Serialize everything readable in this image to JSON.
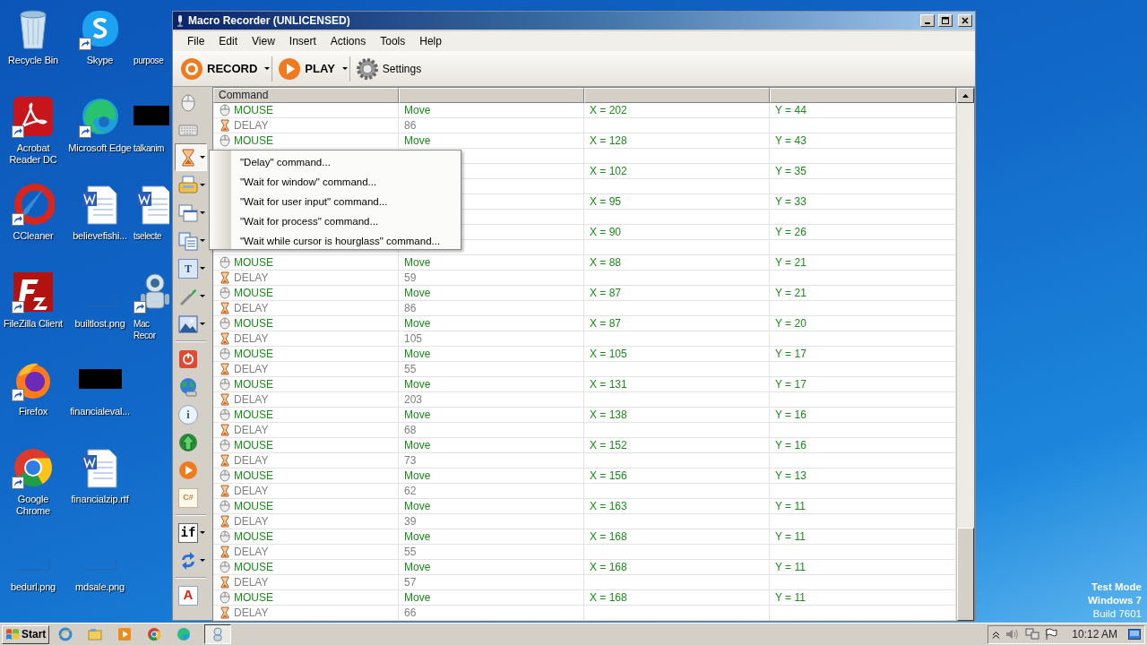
{
  "desktop_icons": [
    {
      "label": "Recycle Bin",
      "kind": "recycle",
      "shortcut": false
    },
    {
      "label": "Acrobat Reader DC",
      "kind": "acrobat",
      "shortcut": true
    },
    {
      "label": "CCleaner",
      "kind": "ccleaner",
      "shortcut": true
    },
    {
      "label": "FileZilla Client",
      "kind": "filezilla",
      "shortcut": true
    },
    {
      "label": "Firefox",
      "kind": "firefox",
      "shortcut": true
    },
    {
      "label": "Google Chrome",
      "kind": "chrome",
      "shortcut": true
    },
    {
      "label": "bedurl.png",
      "kind": "image",
      "shortcut": false
    },
    {
      "label": "Skype",
      "kind": "skype",
      "shortcut": true
    },
    {
      "label": "Microsoft Edge",
      "kind": "edge",
      "shortcut": true
    },
    {
      "label": "believefishi...",
      "kind": "document",
      "shortcut": false
    },
    {
      "label": "builtlost.png",
      "kind": "image",
      "shortcut": false
    },
    {
      "label": "financialeval...",
      "kind": "blackimage",
      "shortcut": false
    },
    {
      "label": "financialzip.rtf",
      "kind": "document",
      "shortcut": false
    },
    {
      "label": "mdsale.png",
      "kind": "image",
      "shortcut": false
    },
    {
      "label": "purpose",
      "kind": "none"
    },
    {
      "label": "talkanim",
      "kind": "blackimage",
      "shortcut": false
    },
    {
      "label": "tselecte",
      "kind": "document",
      "shortcut": false
    },
    {
      "label": "Mac Recor",
      "kind": "robot",
      "shortcut": true
    }
  ],
  "window": {
    "title": "Macro Recorder (UNLICENSED)"
  },
  "menu": [
    "File",
    "Edit",
    "View",
    "Insert",
    "Actions",
    "Tools",
    "Help"
  ],
  "toolbar": [
    {
      "label": "RECORD",
      "kind": "record",
      "dropdown": true
    },
    {
      "label": "PLAY",
      "kind": "play",
      "dropdown": true
    },
    {
      "label": "Settings",
      "kind": "settings",
      "dropdown": false
    }
  ],
  "left_toolbar": [
    {
      "kind": "mouse",
      "dropdown": false,
      "pressed": false
    },
    {
      "kind": "keyboard",
      "dropdown": false,
      "pressed": false
    },
    {
      "kind": "hourglass",
      "dropdown": true,
      "pressed": true
    },
    {
      "kind": "printer",
      "dropdown": true,
      "pressed": false
    },
    {
      "kind": "windows",
      "dropdown": true,
      "pressed": false
    },
    {
      "kind": "documents",
      "dropdown": true,
      "pressed": false
    },
    {
      "kind": "text",
      "label": "T",
      "dropdown": true,
      "pressed": false
    },
    {
      "kind": "eyedropper",
      "dropdown": true,
      "pressed": false
    },
    {
      "kind": "picture",
      "dropdown": true,
      "pressed": false
    },
    {
      "kind": "separator"
    },
    {
      "kind": "power",
      "dropdown": false,
      "pressed": false
    },
    {
      "kind": "globe",
      "dropdown": false,
      "pressed": false
    },
    {
      "kind": "info",
      "label": "i",
      "dropdown": false,
      "pressed": false
    },
    {
      "kind": "upload",
      "dropdown": false,
      "pressed": false
    },
    {
      "kind": "play",
      "dropdown": false,
      "pressed": false
    },
    {
      "kind": "code",
      "label": "C#",
      "dropdown": false,
      "pressed": false
    },
    {
      "kind": "separator"
    },
    {
      "kind": "condition",
      "label": "if",
      "dropdown": true,
      "pressed": false
    },
    {
      "kind": "loop",
      "dropdown": true,
      "pressed": false
    },
    {
      "kind": "separator"
    },
    {
      "kind": "font",
      "label": "A",
      "dropdown": false,
      "pressed": false
    }
  ],
  "table": {
    "columns": [
      "Command"
    ],
    "rows": [
      {
        "kind": "mouse",
        "command": "MOUSE",
        "action": "Move",
        "x": "X = 202",
        "y": "Y = 44"
      },
      {
        "kind": "delay",
        "command": "DELAY",
        "action": "86"
      },
      {
        "kind": "mouse",
        "command": "MOUSE",
        "action": "Move",
        "x": "X = 128",
        "y": "Y = 43"
      },
      {
        "kind": "delay"
      },
      {
        "kind": "mouse",
        "x": "X = 102",
        "y": "Y = 35"
      },
      {
        "kind": "delay"
      },
      {
        "kind": "mouse",
        "x": "X = 95",
        "y": "Y = 33"
      },
      {
        "kind": "delay"
      },
      {
        "kind": "mouse",
        "x": "X = 90",
        "y": "Y = 26"
      },
      {
        "kind": "delay"
      },
      {
        "kind": "mouse",
        "command": "MOUSE",
        "action": "Move",
        "x": "X = 88",
        "y": "Y = 21"
      },
      {
        "kind": "delay",
        "command": "DELAY",
        "action": "59"
      },
      {
        "kind": "mouse",
        "command": "MOUSE",
        "action": "Move",
        "x": "X = 87",
        "y": "Y = 21"
      },
      {
        "kind": "delay",
        "command": "DELAY",
        "action": "86"
      },
      {
        "kind": "mouse",
        "command": "MOUSE",
        "action": "Move",
        "x": "X = 87",
        "y": "Y = 20"
      },
      {
        "kind": "delay",
        "command": "DELAY",
        "action": "105"
      },
      {
        "kind": "mouse",
        "command": "MOUSE",
        "action": "Move",
        "x": "X = 105",
        "y": "Y = 17"
      },
      {
        "kind": "delay",
        "command": "DELAY",
        "action": "55"
      },
      {
        "kind": "mouse",
        "command": "MOUSE",
        "action": "Move",
        "x": "X = 131",
        "y": "Y = 17"
      },
      {
        "kind": "delay",
        "command": "DELAY",
        "action": "203"
      },
      {
        "kind": "mouse",
        "command": "MOUSE",
        "action": "Move",
        "x": "X = 138",
        "y": "Y = 16"
      },
      {
        "kind": "delay",
        "command": "DELAY",
        "action": "68"
      },
      {
        "kind": "mouse",
        "command": "MOUSE",
        "action": "Move",
        "x": "X = 152",
        "y": "Y = 16"
      },
      {
        "kind": "delay",
        "command": "DELAY",
        "action": "73"
      },
      {
        "kind": "mouse",
        "command": "MOUSE",
        "action": "Move",
        "x": "X = 156",
        "y": "Y = 13"
      },
      {
        "kind": "delay",
        "command": "DELAY",
        "action": "62"
      },
      {
        "kind": "mouse",
        "command": "MOUSE",
        "action": "Move",
        "x": "X = 163",
        "y": "Y = 11"
      },
      {
        "kind": "delay",
        "command": "DELAY",
        "action": "39"
      },
      {
        "kind": "mouse",
        "command": "MOUSE",
        "action": "Move",
        "x": "X = 168",
        "y": "Y = 11"
      },
      {
        "kind": "delay",
        "command": "DELAY",
        "action": "55"
      },
      {
        "kind": "mouse",
        "command": "MOUSE",
        "action": "Move",
        "x": "X = 168",
        "y": "Y = 11"
      },
      {
        "kind": "delay",
        "command": "DELAY",
        "action": "57"
      },
      {
        "kind": "mouse",
        "command": "MOUSE",
        "action": "Move",
        "x": "X = 168",
        "y": "Y = 11"
      },
      {
        "kind": "delay",
        "command": "DELAY",
        "action": "66"
      }
    ]
  },
  "popup_menu": [
    "\"Delay\" command...",
    "\"Wait for window\" command...",
    "\"Wait for user input\" command...",
    "\"Wait for process\" command...",
    "\"Wait while cursor is hourglass\" command..."
  ],
  "os_notice": [
    "Test Mode",
    "Windows 7",
    "Build 7601"
  ],
  "taskbar": {
    "start": "Start",
    "apps": [
      {
        "kind": "ie",
        "active": false
      },
      {
        "kind": "explorer",
        "active": false
      },
      {
        "kind": "media",
        "active": false
      },
      {
        "kind": "chrome",
        "active": false
      },
      {
        "kind": "edge",
        "active": false
      },
      {
        "kind": "recorder",
        "active": true
      }
    ],
    "clock": "10:12 AM"
  }
}
